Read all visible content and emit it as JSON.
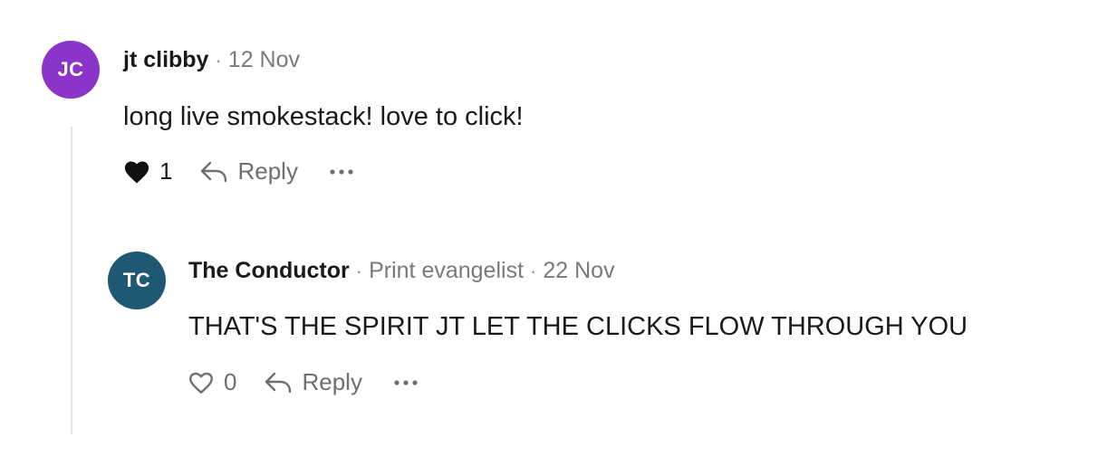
{
  "thread": {
    "comment": {
      "avatar_initials": "JC",
      "avatar_color": "#8a34c9",
      "author": "jt clibby",
      "separator": "·",
      "date": "12 Nov",
      "text": "long live smokestack! love to click!",
      "like_count": "1",
      "liked": true,
      "reply_label": "Reply",
      "more_icon": "ellipsis-icon"
    },
    "reply": {
      "avatar_initials": "TC",
      "avatar_color": "#1f5873",
      "author": "The Conductor",
      "separator": "·",
      "badge": "Print evangelist",
      "date": "22 Nov",
      "text": "THAT'S THE SPIRIT JT LET THE CLICKS FLOW THROUGH YOU",
      "like_count": "0",
      "liked": false,
      "reply_label": "Reply",
      "more_icon": "ellipsis-icon"
    }
  }
}
